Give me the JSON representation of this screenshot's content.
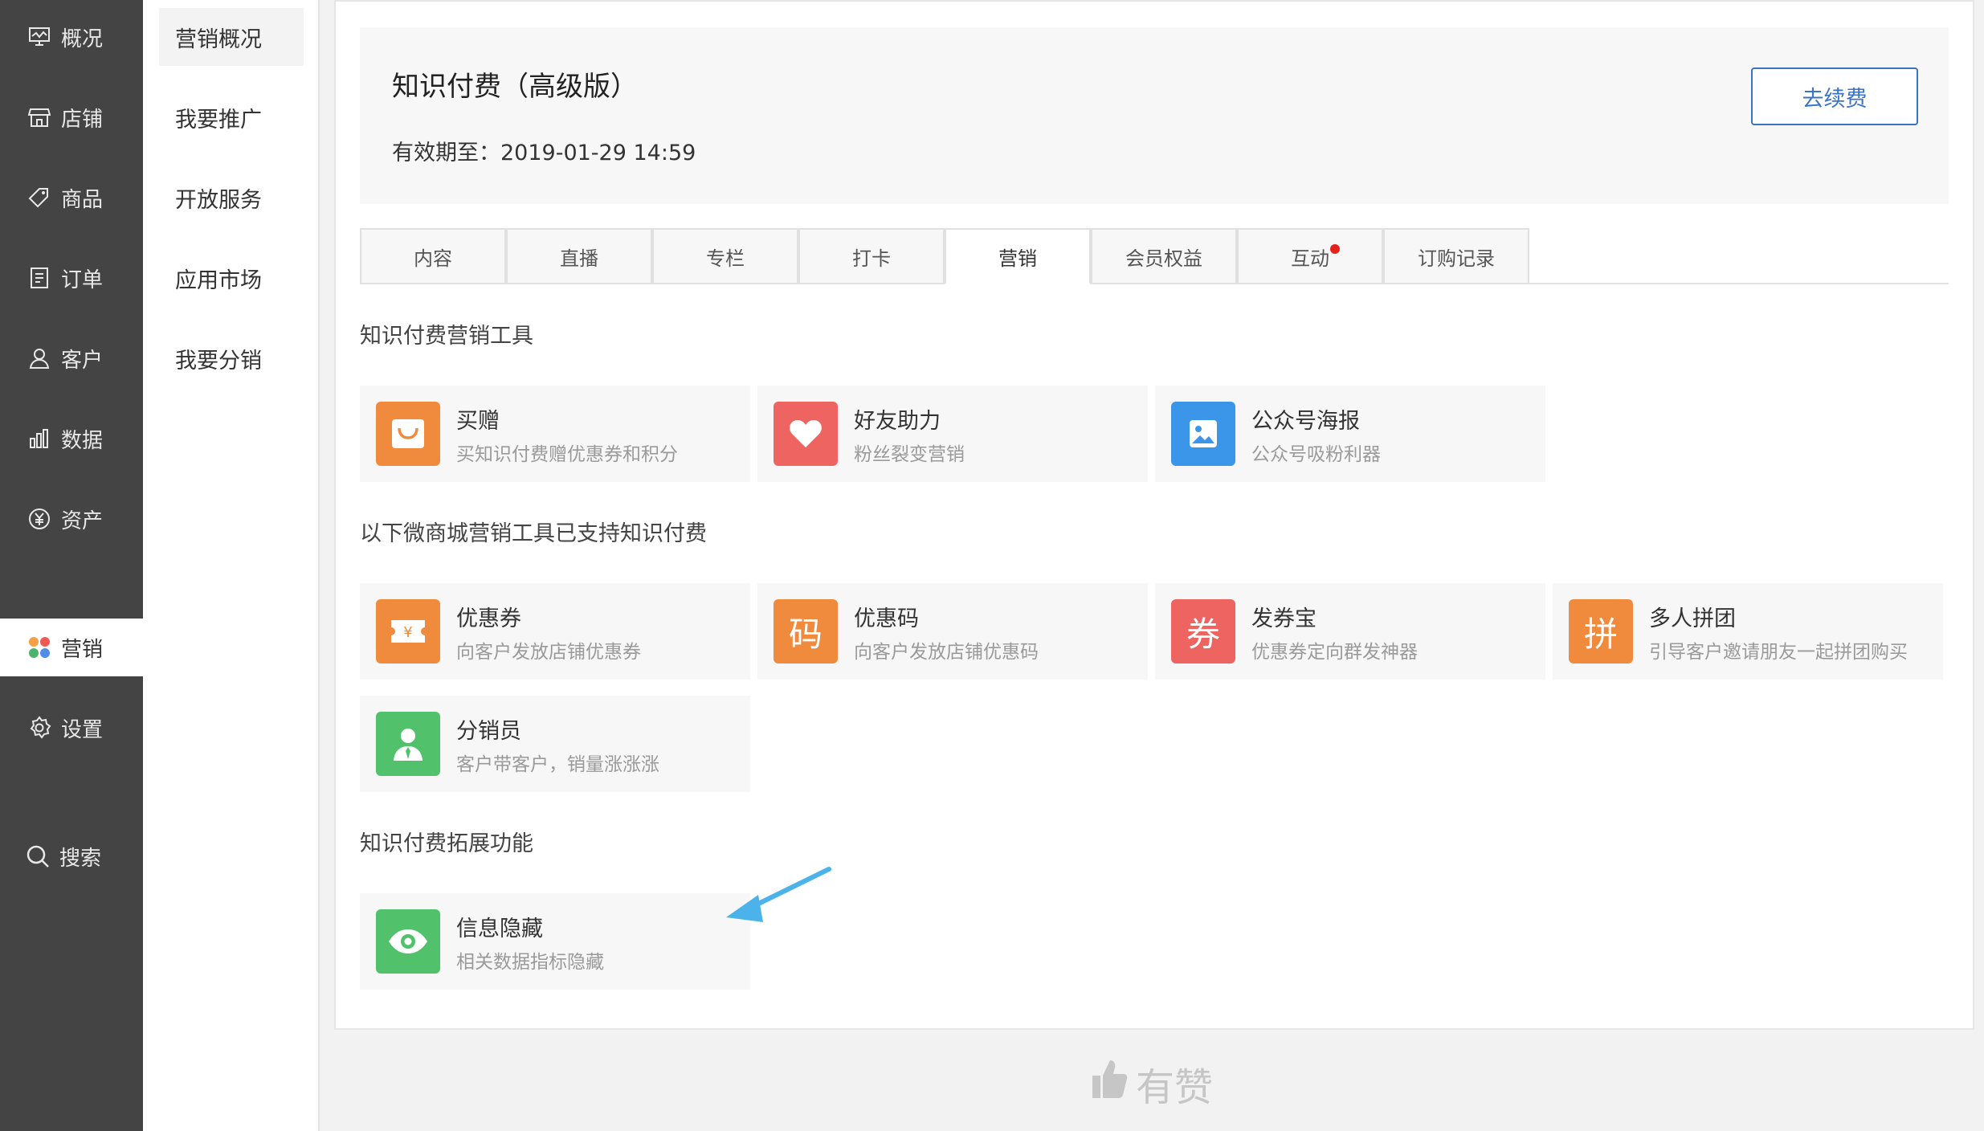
{
  "nav": {
    "items": [
      {
        "label": "概况",
        "icon": "monitor-icon"
      },
      {
        "label": "店铺",
        "icon": "store-icon"
      },
      {
        "label": "商品",
        "icon": "tag-icon"
      },
      {
        "label": "订单",
        "icon": "list-icon"
      },
      {
        "label": "客户",
        "icon": "user-icon"
      },
      {
        "label": "数据",
        "icon": "bar-chart-icon"
      },
      {
        "label": "资产",
        "icon": "yen-icon"
      },
      {
        "label": "营销",
        "icon": "four-dots-icon",
        "active": true
      },
      {
        "label": "设置",
        "icon": "gear-icon"
      }
    ],
    "search_label": "搜索"
  },
  "subnav": {
    "items": [
      {
        "label": "营销概况",
        "active": true
      },
      {
        "label": "我要推广"
      },
      {
        "label": "开放服务"
      },
      {
        "label": "应用市场"
      },
      {
        "label": "我要分销"
      }
    ]
  },
  "header": {
    "title": "知识付费（高级版）",
    "expire_label": "有效期至：",
    "expire_value": "2019-01-29 14:59",
    "renew_button": "去续费"
  },
  "tabs": [
    {
      "label": "内容"
    },
    {
      "label": "直播"
    },
    {
      "label": "专栏"
    },
    {
      "label": "打卡"
    },
    {
      "label": "营销",
      "active": true
    },
    {
      "label": "会员权益"
    },
    {
      "label": "互动",
      "badge": true
    },
    {
      "label": "订购记录"
    }
  ],
  "sections": [
    {
      "title": "知识付费营销工具",
      "tools": [
        {
          "name": "买赠",
          "desc": "买知识付费赠优惠券和积分",
          "icon": "shopping-bag-icon",
          "color": "#f08a3c"
        },
        {
          "name": "好友助力",
          "desc": "粉丝裂变营销",
          "icon": "heart-icon",
          "color": "#ee6461"
        },
        {
          "name": "公众号海报",
          "desc": "公众号吸粉利器",
          "icon": "poster-icon",
          "color": "#3b95e8"
        }
      ]
    },
    {
      "title": "以下微商城营销工具已支持知识付费",
      "tools": [
        {
          "name": "优惠券",
          "desc": "向客户发放店铺优惠券",
          "icon": "coupon-icon",
          "color": "#f08a3c"
        },
        {
          "name": "优惠码",
          "desc": "向客户发放店铺优惠码",
          "icon": "code-icon",
          "glyph": "码",
          "color": "#f08a3c"
        },
        {
          "name": "发券宝",
          "desc": "优惠券定向群发神器",
          "icon": "voucher-icon",
          "glyph": "券",
          "color": "#ee6461"
        },
        {
          "name": "多人拼团",
          "desc": "引导客户邀请朋友一起拼团购买",
          "icon": "group-buy-icon",
          "glyph": "拼",
          "color": "#f08a3c"
        },
        {
          "name": "分销员",
          "desc": "客户带客户，销量涨涨涨",
          "icon": "distributor-icon",
          "color": "#52c16b"
        }
      ]
    },
    {
      "title": "知识付费拓展功能",
      "tools": [
        {
          "name": "信息隐藏",
          "desc": "相关数据指标隐藏",
          "icon": "eye-icon",
          "color": "#52c16b"
        }
      ]
    }
  ],
  "brand": {
    "label": "有赞",
    "icon": "thumbs-up-icon"
  },
  "accent": {
    "annotation_arrow": "#4bb3ea",
    "link_blue": "#3b73c6",
    "badge_red": "#e3231b"
  }
}
